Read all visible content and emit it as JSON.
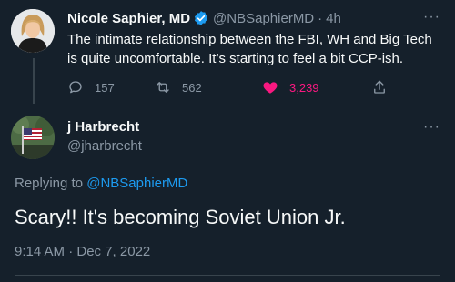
{
  "tweet1": {
    "name": "Nicole Saphier, MD",
    "handle": "@NBSaphierMD",
    "separator": "·",
    "time": "4h",
    "more": "···",
    "text": "The intimate relationship between the FBI, WH and Big Tech is quite uncomfortable. It’s starting to feel a bit CCP-ish.",
    "stats": {
      "replies": "157",
      "retweets": "562",
      "likes": "3,239"
    }
  },
  "tweet2": {
    "name": "j Harbrecht",
    "handle": "@jharbrecht",
    "more": "···",
    "replying_prefix": "Replying to",
    "replying_handle": "@NBSaphierMD",
    "text": "Scary!! It's becoming Soviet Union Jr.",
    "meta": "9:14 AM · Dec 7, 2022"
  },
  "icons": {
    "verified": "verified-badge-icon",
    "reply": "reply-icon",
    "retweet": "retweet-icon",
    "like": "heart-icon",
    "share": "share-icon"
  },
  "colors": {
    "background": "#15202b",
    "accent": "#1d9bf0",
    "like": "#f91880",
    "muted": "#8b98a5",
    "text": "#f7f9f9"
  }
}
